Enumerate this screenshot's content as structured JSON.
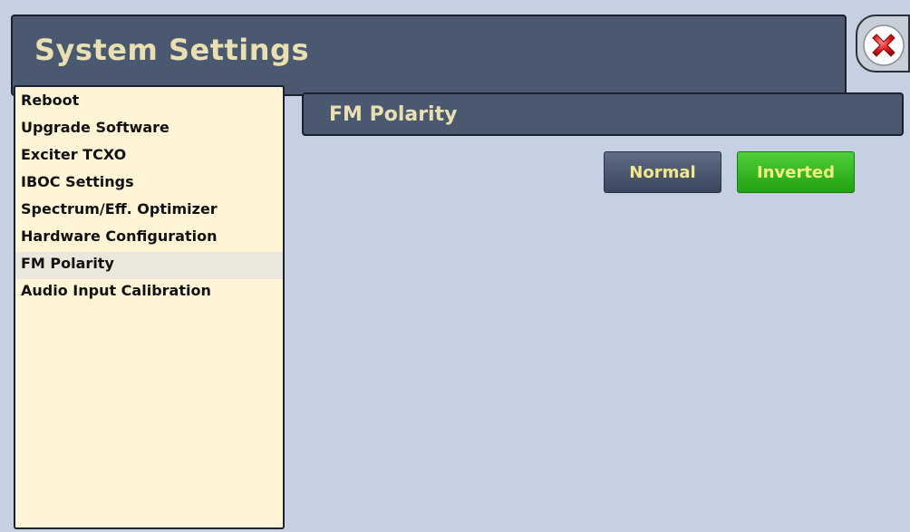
{
  "window": {
    "title": "System Settings",
    "close_icon": "close-icon"
  },
  "sidebar": {
    "items": [
      {
        "label": "Reboot"
      },
      {
        "label": "Upgrade Software"
      },
      {
        "label": "Exciter TCXO"
      },
      {
        "label": "IBOC Settings"
      },
      {
        "label": "Spectrum/Eff. Optimizer"
      },
      {
        "label": "Hardware Configuration"
      },
      {
        "label": "FM Polarity"
      },
      {
        "label": "Audio Input Calibration"
      }
    ],
    "selected": "FM Polarity"
  },
  "panel": {
    "title": "FM Polarity",
    "buttons": {
      "normal_label": "Normal",
      "inverted_label": "Inverted"
    },
    "active_option": "Inverted"
  },
  "colors": {
    "background": "#c5d0e2",
    "header": "#4a5870",
    "title_text": "#e8e0b0",
    "sidebar_bg": "#fff5d6",
    "active_button": "#2db51a",
    "inactive_button": "#4a5870"
  }
}
